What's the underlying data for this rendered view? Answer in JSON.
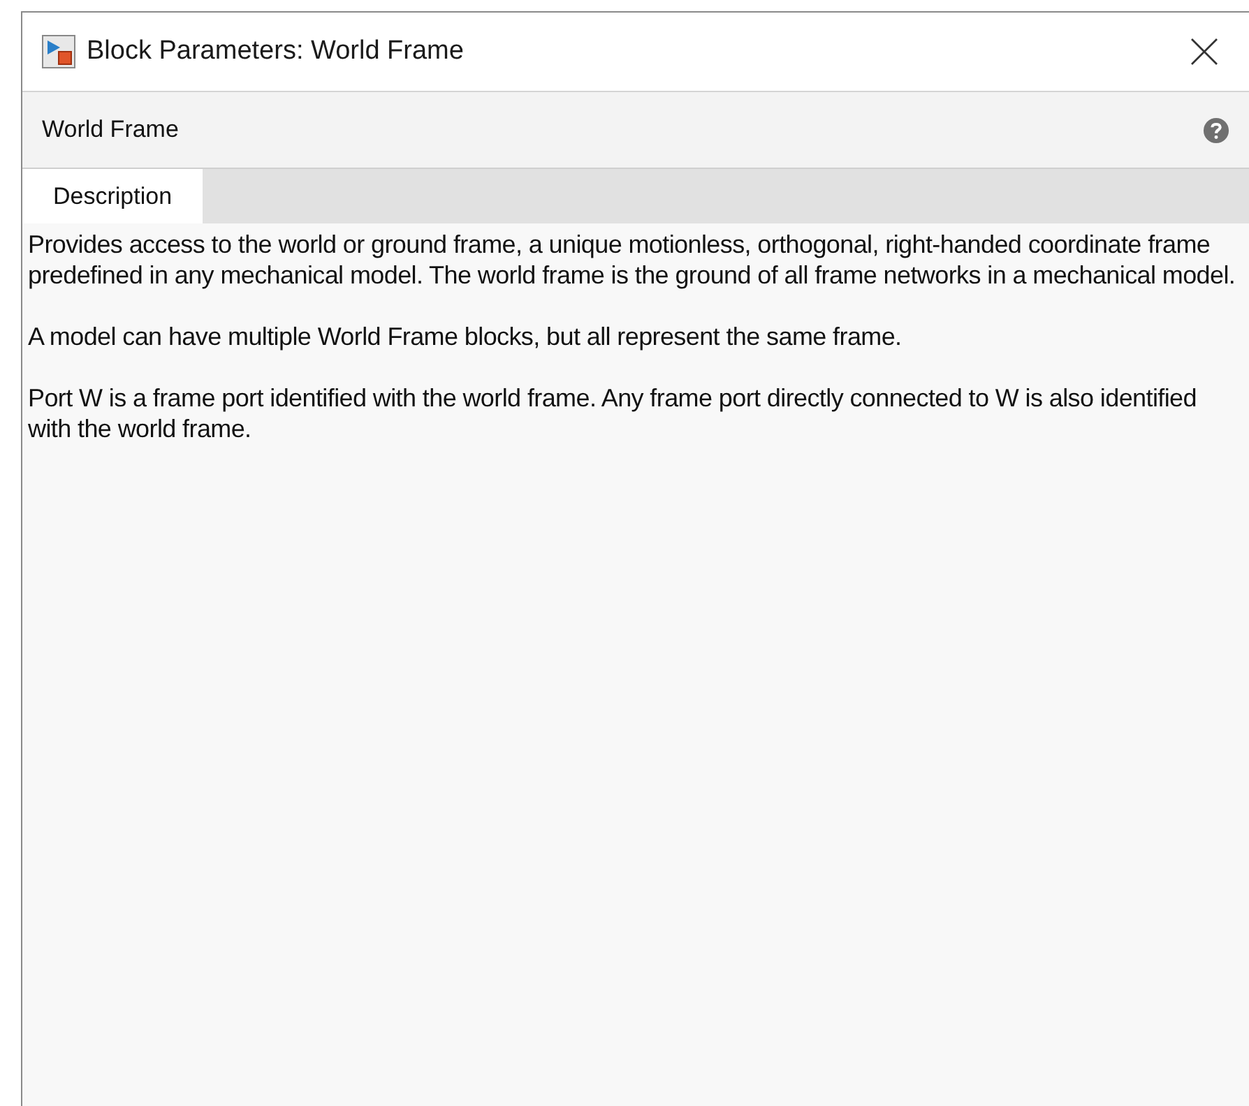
{
  "window": {
    "title": "Block Parameters: World Frame"
  },
  "header": {
    "title": "World Frame"
  },
  "tabs": [
    {
      "label": "Description",
      "selected": true
    }
  ],
  "description": [
    "Provides access to the world or ground frame, a unique motionless, orthogonal, right-handed coordinate frame predefined in any mechanical model. The world frame is the ground of all frame networks in a mechanical model.",
    "A model can have multiple World Frame blocks, but all represent the same frame.",
    "Port W is a frame port identified with the world frame. Any frame port directly connected to W is also identified with the world frame."
  ]
}
